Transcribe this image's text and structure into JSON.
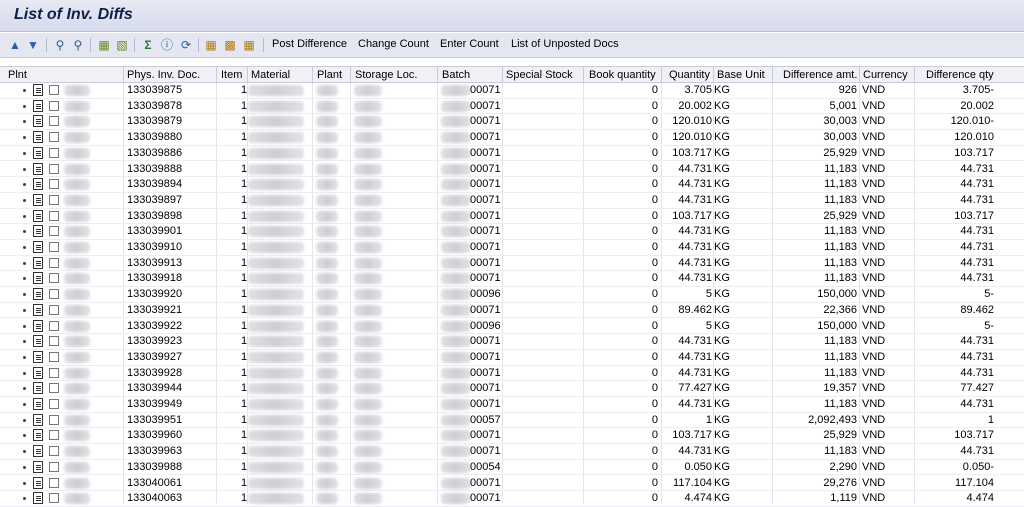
{
  "window": {
    "title": "List of Inv. Diffs"
  },
  "toolbar": {
    "icons": [
      "sort-ascending-icon",
      "sort-descending-icon",
      "find-icon",
      "find-next-icon",
      "set-filter-icon",
      "delete-filter-icon",
      "sum-icon",
      "subtotal-icon",
      "refresh-icon",
      "grid-layout-icon",
      "choose-layout-icon",
      "save-layout-icon"
    ],
    "buttons": {
      "post_difference": "Post Difference",
      "change_count": "Change Count",
      "enter_count": "Enter Count",
      "list_unposted": "List of Unposted Docs"
    }
  },
  "table": {
    "columns": {
      "plnt": "Plnt",
      "phys_inv_doc": "Phys. Inv. Doc.",
      "item": "Item",
      "material": "Material",
      "plant": "Plant",
      "storage_loc": "Storage Loc.",
      "batch": "Batch",
      "special_stock": "Special Stock",
      "book_quantity": "Book quantity",
      "quantity": "Quantity",
      "base_unit": "Base Unit",
      "difference_amt": "Difference amt.",
      "currency": "Currency",
      "difference_qty": "Difference qty"
    },
    "rows": [
      {
        "doc": "133039875",
        "item": "1",
        "batch": "00071",
        "book": "0",
        "qty": "3.705",
        "unit": "KG",
        "amt": "926",
        "cur": "VND",
        "diff": "3.705-"
      },
      {
        "doc": "133039878",
        "item": "1",
        "batch": "00071",
        "book": "0",
        "qty": "20.002",
        "unit": "KG",
        "amt": "5,001",
        "cur": "VND",
        "diff": "20.002"
      },
      {
        "doc": "133039879",
        "item": "1",
        "batch": "00071",
        "book": "0",
        "qty": "120.010",
        "unit": "KG",
        "amt": "30,003",
        "cur": "VND",
        "diff": "120.010-"
      },
      {
        "doc": "133039880",
        "item": "1",
        "batch": "00071",
        "book": "0",
        "qty": "120.010",
        "unit": "KG",
        "amt": "30,003",
        "cur": "VND",
        "diff": "120.010"
      },
      {
        "doc": "133039886",
        "item": "1",
        "batch": "00071",
        "book": "0",
        "qty": "103.717",
        "unit": "KG",
        "amt": "25,929",
        "cur": "VND",
        "diff": "103.717"
      },
      {
        "doc": "133039888",
        "item": "1",
        "batch": "00071",
        "book": "0",
        "qty": "44.731",
        "unit": "KG",
        "amt": "11,183",
        "cur": "VND",
        "diff": "44.731"
      },
      {
        "doc": "133039894",
        "item": "1",
        "batch": "00071",
        "book": "0",
        "qty": "44.731",
        "unit": "KG",
        "amt": "11,183",
        "cur": "VND",
        "diff": "44.731"
      },
      {
        "doc": "133039897",
        "item": "1",
        "batch": "00071",
        "book": "0",
        "qty": "44.731",
        "unit": "KG",
        "amt": "11,183",
        "cur": "VND",
        "diff": "44.731"
      },
      {
        "doc": "133039898",
        "item": "1",
        "batch": "00071",
        "book": "0",
        "qty": "103.717",
        "unit": "KG",
        "amt": "25,929",
        "cur": "VND",
        "diff": "103.717"
      },
      {
        "doc": "133039901",
        "item": "1",
        "batch": "00071",
        "book": "0",
        "qty": "44.731",
        "unit": "KG",
        "amt": "11,183",
        "cur": "VND",
        "diff": "44.731"
      },
      {
        "doc": "133039910",
        "item": "1",
        "batch": "00071",
        "book": "0",
        "qty": "44.731",
        "unit": "KG",
        "amt": "11,183",
        "cur": "VND",
        "diff": "44.731"
      },
      {
        "doc": "133039913",
        "item": "1",
        "batch": "00071",
        "book": "0",
        "qty": "44.731",
        "unit": "KG",
        "amt": "11,183",
        "cur": "VND",
        "diff": "44.731"
      },
      {
        "doc": "133039918",
        "item": "1",
        "batch": "00071",
        "book": "0",
        "qty": "44.731",
        "unit": "KG",
        "amt": "11,183",
        "cur": "VND",
        "diff": "44.731"
      },
      {
        "doc": "133039920",
        "item": "1",
        "batch": "00096",
        "book": "0",
        "qty": "5",
        "unit": "KG",
        "amt": "150,000",
        "cur": "VND",
        "diff": "5-"
      },
      {
        "doc": "133039921",
        "item": "1",
        "batch": "00071",
        "book": "0",
        "qty": "89.462",
        "unit": "KG",
        "amt": "22,366",
        "cur": "VND",
        "diff": "89.462"
      },
      {
        "doc": "133039922",
        "item": "1",
        "batch": "00096",
        "book": "0",
        "qty": "5",
        "unit": "KG",
        "amt": "150,000",
        "cur": "VND",
        "diff": "5-"
      },
      {
        "doc": "133039923",
        "item": "1",
        "batch": "00071",
        "book": "0",
        "qty": "44.731",
        "unit": "KG",
        "amt": "11,183",
        "cur": "VND",
        "diff": "44.731"
      },
      {
        "doc": "133039927",
        "item": "1",
        "batch": "00071",
        "book": "0",
        "qty": "44.731",
        "unit": "KG",
        "amt": "11,183",
        "cur": "VND",
        "diff": "44.731"
      },
      {
        "doc": "133039928",
        "item": "1",
        "batch": "00071",
        "book": "0",
        "qty": "44.731",
        "unit": "KG",
        "amt": "11,183",
        "cur": "VND",
        "diff": "44.731"
      },
      {
        "doc": "133039944",
        "item": "1",
        "batch": "00071",
        "book": "0",
        "qty": "77.427",
        "unit": "KG",
        "amt": "19,357",
        "cur": "VND",
        "diff": "77.427"
      },
      {
        "doc": "133039949",
        "item": "1",
        "batch": "00071",
        "book": "0",
        "qty": "44.731",
        "unit": "KG",
        "amt": "11,183",
        "cur": "VND",
        "diff": "44.731"
      },
      {
        "doc": "133039951",
        "item": "1",
        "batch": "00057",
        "book": "0",
        "qty": "1",
        "unit": "KG",
        "amt": "2,092,493",
        "cur": "VND",
        "diff": "1"
      },
      {
        "doc": "133039960",
        "item": "1",
        "batch": "00071",
        "book": "0",
        "qty": "103.717",
        "unit": "KG",
        "amt": "25,929",
        "cur": "VND",
        "diff": "103.717"
      },
      {
        "doc": "133039963",
        "item": "1",
        "batch": "00071",
        "book": "0",
        "qty": "44.731",
        "unit": "KG",
        "amt": "11,183",
        "cur": "VND",
        "diff": "44.731"
      },
      {
        "doc": "133039988",
        "item": "1",
        "batch": "00054",
        "book": "0",
        "qty": "0.050",
        "unit": "KG",
        "amt": "2,290",
        "cur": "VND",
        "diff": "0.050-"
      },
      {
        "doc": "133040061",
        "item": "1",
        "batch": "00071",
        "book": "0",
        "qty": "117.104",
        "unit": "KG",
        "amt": "29,276",
        "cur": "VND",
        "diff": "117.104"
      },
      {
        "doc": "133040063",
        "item": "1",
        "batch": "00071",
        "book": "0",
        "qty": "4.474",
        "unit": "KG",
        "amt": "1,119",
        "cur": "VND",
        "diff": "4.474"
      }
    ]
  }
}
